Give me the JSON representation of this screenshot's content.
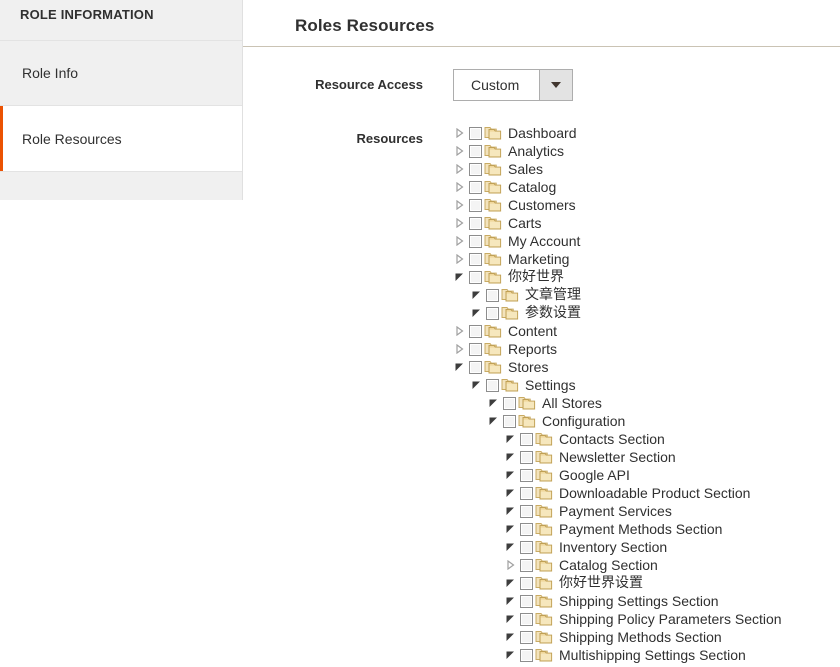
{
  "sidebar": {
    "title": "ROLE INFORMATION",
    "items": [
      {
        "label": "Role Info",
        "active": false
      },
      {
        "label": "Role Resources",
        "active": true
      }
    ]
  },
  "main": {
    "section_title": "Roles Resources",
    "resource_access": {
      "label": "Resource Access",
      "value": "Custom",
      "arrow_icon": "caret-down-icon"
    },
    "resources": {
      "label": "Resources"
    }
  },
  "colors": {
    "accent": "#eb5202",
    "sidebar_bg": "#f0f0f0",
    "divider": "#cac3b4",
    "text": "#303030",
    "folder": "#e8cf8e"
  },
  "tree": [
    {
      "label": "Dashboard",
      "depth": 0,
      "state": "collapsed",
      "checked": false
    },
    {
      "label": "Analytics",
      "depth": 0,
      "state": "collapsed",
      "checked": false
    },
    {
      "label": "Sales",
      "depth": 0,
      "state": "collapsed",
      "checked": false
    },
    {
      "label": "Catalog",
      "depth": 0,
      "state": "collapsed",
      "checked": false
    },
    {
      "label": "Customers",
      "depth": 0,
      "state": "collapsed",
      "checked": false
    },
    {
      "label": "Carts",
      "depth": 0,
      "state": "collapsed",
      "checked": false
    },
    {
      "label": "My Account",
      "depth": 0,
      "state": "collapsed",
      "checked": false
    },
    {
      "label": "Marketing",
      "depth": 0,
      "state": "collapsed",
      "checked": false
    },
    {
      "label": "你好世界",
      "depth": 0,
      "state": "expanded",
      "checked": false,
      "cjk": true
    },
    {
      "label": "文章管理",
      "depth": 1,
      "state": "expanded",
      "checked": false,
      "cjk": true
    },
    {
      "label": "参数设置",
      "depth": 1,
      "state": "expanded",
      "checked": false,
      "cjk": true
    },
    {
      "label": "Content",
      "depth": 0,
      "state": "collapsed",
      "checked": false
    },
    {
      "label": "Reports",
      "depth": 0,
      "state": "collapsed",
      "checked": false
    },
    {
      "label": "Stores",
      "depth": 0,
      "state": "expanded",
      "checked": false
    },
    {
      "label": "Settings",
      "depth": 1,
      "state": "expanded",
      "checked": false
    },
    {
      "label": "All Stores",
      "depth": 2,
      "state": "expanded",
      "checked": false
    },
    {
      "label": "Configuration",
      "depth": 2,
      "state": "expanded",
      "checked": false
    },
    {
      "label": "Contacts Section",
      "depth": 3,
      "state": "expanded",
      "checked": false
    },
    {
      "label": "Newsletter Section",
      "depth": 3,
      "state": "expanded",
      "checked": false
    },
    {
      "label": "Google API",
      "depth": 3,
      "state": "expanded",
      "checked": false
    },
    {
      "label": "Downloadable Product Section",
      "depth": 3,
      "state": "expanded",
      "checked": false
    },
    {
      "label": "Payment Services",
      "depth": 3,
      "state": "expanded",
      "checked": false
    },
    {
      "label": "Payment Methods Section",
      "depth": 3,
      "state": "expanded",
      "checked": false
    },
    {
      "label": "Inventory Section",
      "depth": 3,
      "state": "expanded",
      "checked": false
    },
    {
      "label": "Catalog Section",
      "depth": 3,
      "state": "collapsed",
      "checked": false
    },
    {
      "label": "你好世界设置",
      "depth": 3,
      "state": "expanded",
      "checked": false,
      "cjk": true
    },
    {
      "label": "Shipping Settings Section",
      "depth": 3,
      "state": "expanded",
      "checked": false
    },
    {
      "label": "Shipping Policy Parameters Section",
      "depth": 3,
      "state": "expanded",
      "checked": false
    },
    {
      "label": "Shipping Methods Section",
      "depth": 3,
      "state": "expanded",
      "checked": false
    },
    {
      "label": "Multishipping Settings Section",
      "depth": 3,
      "state": "expanded",
      "checked": false
    }
  ]
}
